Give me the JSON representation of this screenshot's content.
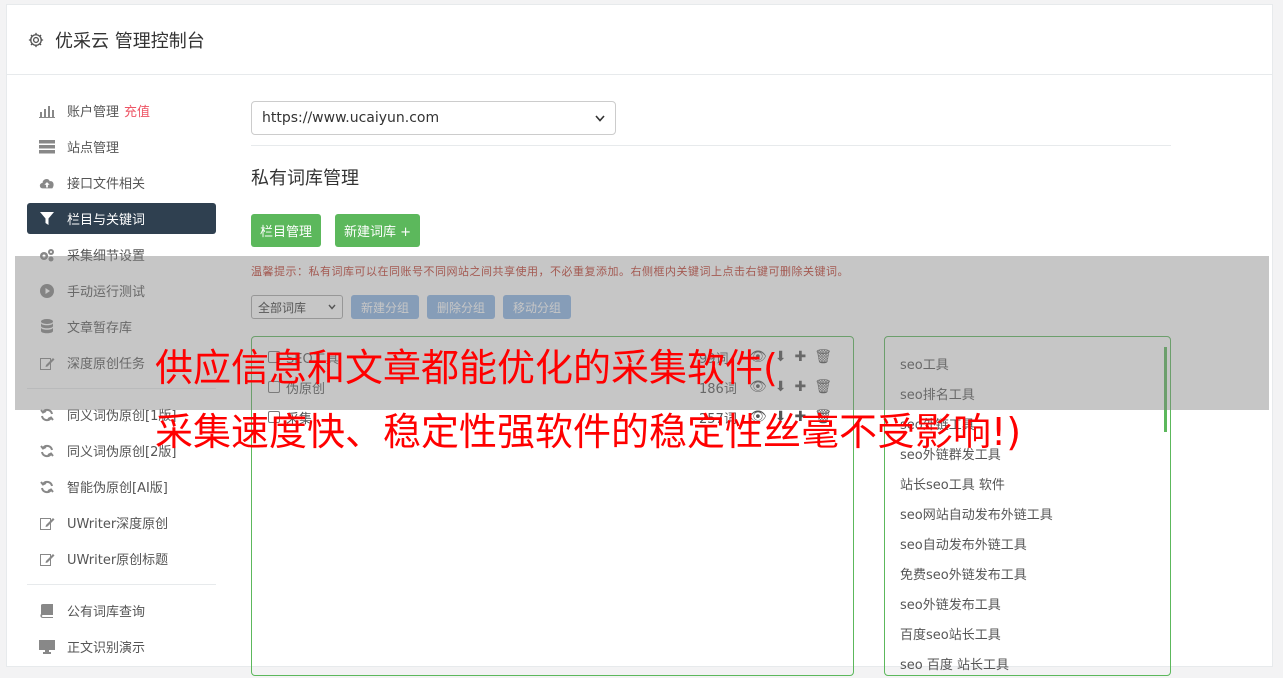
{
  "app": {
    "title": "优采云 管理控制台"
  },
  "sidebar": {
    "items": [
      {
        "label": "账户管理",
        "extra": "充值",
        "icon": "bar-chart-icon"
      },
      {
        "label": "站点管理",
        "icon": "server-icon"
      },
      {
        "label": "接口文件相关",
        "icon": "cloud-upload-icon"
      },
      {
        "label": "栏目与关键词",
        "icon": "filter-icon",
        "active": true
      },
      {
        "label": "采集细节设置",
        "icon": "gears-icon"
      },
      {
        "label": "手动运行测试",
        "icon": "play-circle-icon"
      },
      {
        "label": "文章暂存库",
        "icon": "database-icon"
      },
      {
        "label": "深度原创任务",
        "icon": "edit-icon"
      },
      {
        "label": "同义词伪原创[1版]",
        "icon": "refresh-icon"
      },
      {
        "label": "同义词伪原创[2版]",
        "icon": "refresh-icon"
      },
      {
        "label": "智能伪原创[AI版]",
        "icon": "refresh-icon"
      },
      {
        "label": "UWriter深度原创",
        "icon": "edit-icon"
      },
      {
        "label": "UWriter原创标题",
        "icon": "edit-icon"
      },
      {
        "label": "公有词库查询",
        "icon": "book-icon"
      },
      {
        "label": "正文识别演示",
        "icon": "desktop-icon"
      }
    ]
  },
  "main": {
    "site_select": "https://www.ucaiyun.com",
    "section_title": "私有词库管理",
    "btn_columns": "栏目管理",
    "btn_new_lib": "新建词库 +",
    "tip": "温馨提示：私有词库可以在同账号不同网站之间共享使用，不必重复添加。右侧框内关键词上点击右键可删除关键词。",
    "filter_select": "全部词库",
    "btn_new_group": "新建分组",
    "btn_delete_group": "删除分组",
    "btn_move_group": "移动分组",
    "groups": [
      {
        "name": "SEO工具",
        "count": "99词"
      },
      {
        "name": "伪原创",
        "count": "186词"
      },
      {
        "name": "采集",
        "count": "257词"
      }
    ],
    "keywords": [
      "seo工具",
      "seo排名工具",
      "seo外链工具",
      "seo外链群发工具",
      "站长seo工具 软件",
      "seo网站自动发布外链工具",
      "seo自动发布外链工具",
      "免费seo外链发布工具",
      "seo外链发布工具",
      "百度seo站长工具",
      "seo 百度 站长工具"
    ]
  },
  "overlay": {
    "line1": "供应信息和文章都能优化的采集软件(",
    "line2": "采集速度快、稳定性强软件的稳定性丝毫不受影响!)"
  },
  "colors": {
    "accent_green": "#5cb85c",
    "nav_active": "#2f4050",
    "headline_red": "#ff0000"
  }
}
